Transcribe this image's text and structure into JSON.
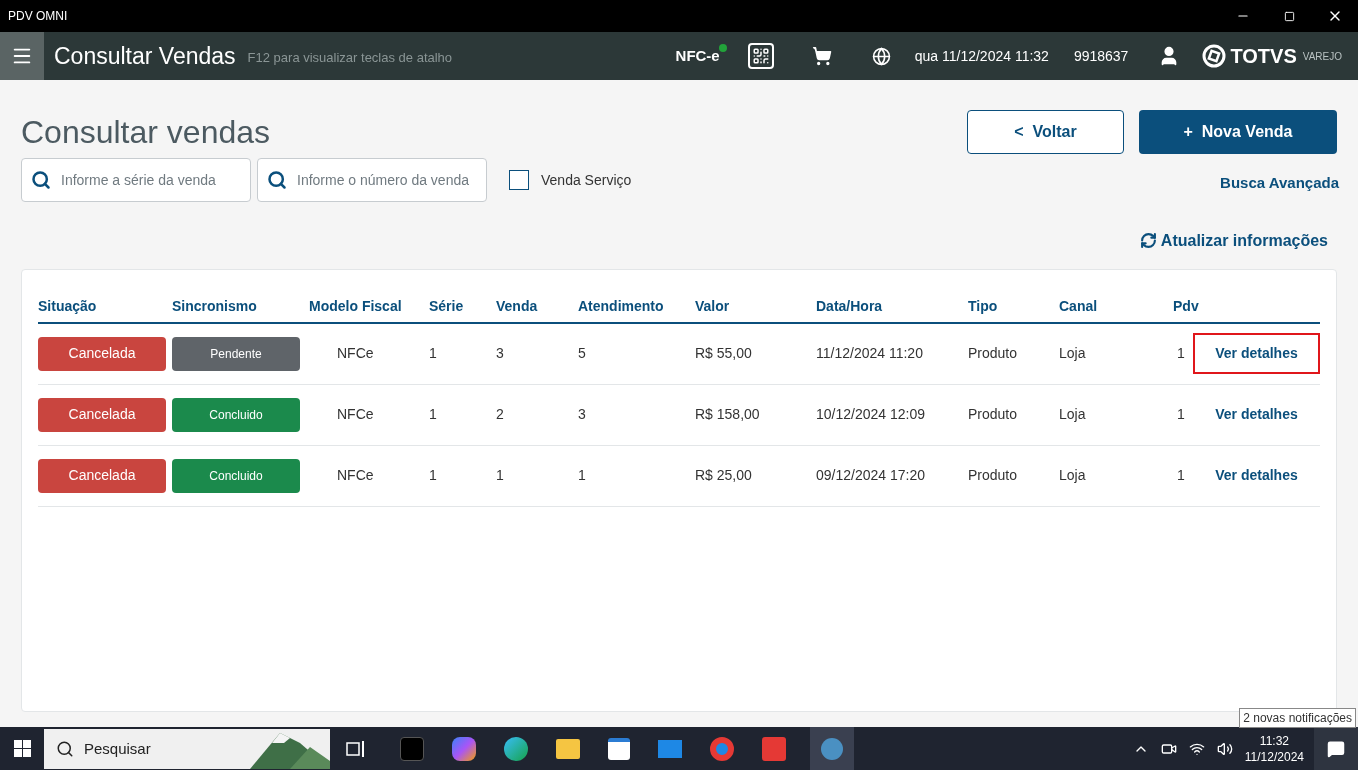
{
  "window": {
    "title": "PDV OMNI"
  },
  "header": {
    "title": "Consultar Vendas",
    "hint": "F12 para visualizar teclas de atalho",
    "nfce": "NFC-e",
    "nfce_online": true,
    "datetime": "qua 11/12/2024 11:32",
    "code": "9918637",
    "brand": "TOTVS",
    "brand_sub": "VAREJO"
  },
  "page": {
    "title": "Consultar vendas",
    "back_button": "<  Voltar",
    "new_button": "+  Nova Venda",
    "serie_field": {
      "placeholder": "Informe a série da venda"
    },
    "numero_field": {
      "placeholder": "Informe o número da venda"
    },
    "service_checkbox": {
      "label": "Venda Serviço",
      "checked": false
    },
    "advanced_search": "Busca Avançada",
    "refresh": "Atualizar informações"
  },
  "table": {
    "columns": [
      "Situação",
      "Sincronismo",
      "Modelo Fiscal",
      "Série",
      "Venda",
      "Atendimento",
      "Valor",
      "Data/Hora",
      "Tipo",
      "Canal",
      "Pdv"
    ],
    "rows": [
      {
        "situacao": {
          "label": "Cancelada",
          "color": "#c9453f"
        },
        "sincronismo": {
          "label": "Pendente",
          "color": "#5f6469"
        },
        "modelo": "NFCe",
        "serie": "1",
        "venda": "3",
        "atendimento": "5",
        "valor": "R$ 55,00",
        "data": "11/12/2024 11:20",
        "tipo": "Produto",
        "canal": "Loja",
        "pdv": "1",
        "link": "Ver detalhes",
        "highlighted": true
      },
      {
        "situacao": {
          "label": "Cancelada",
          "color": "#c9453f"
        },
        "sincronismo": {
          "label": "Concluido",
          "color": "#1b8a4c"
        },
        "modelo": "NFCe",
        "serie": "1",
        "venda": "2",
        "atendimento": "3",
        "valor": "R$ 158,00",
        "data": "10/12/2024 12:09",
        "tipo": "Produto",
        "canal": "Loja",
        "pdv": "1",
        "link": "Ver detalhes",
        "highlighted": false
      },
      {
        "situacao": {
          "label": "Cancelada",
          "color": "#c9453f"
        },
        "sincronismo": {
          "label": "Concluido",
          "color": "#1b8a4c"
        },
        "modelo": "NFCe",
        "serie": "1",
        "venda": "1",
        "atendimento": "1",
        "valor": "R$ 25,00",
        "data": "09/12/2024 17:20",
        "tipo": "Produto",
        "canal": "Loja",
        "pdv": "1",
        "link": "Ver detalhes",
        "highlighted": false
      }
    ]
  },
  "taskbar": {
    "search": {
      "placeholder": "Pesquisar"
    },
    "time": "11:32",
    "date": "11/12/2024",
    "tooltip": "2 novas notificações"
  }
}
